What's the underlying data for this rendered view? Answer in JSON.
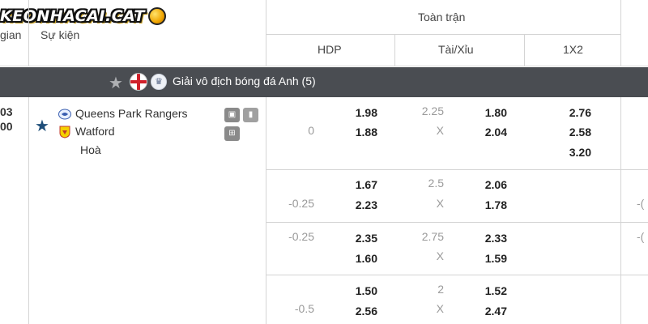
{
  "brand": {
    "logo_text": "KEONHACAI.CAT"
  },
  "header": {
    "time_col": "gian",
    "event_col": "Sự kiện",
    "full_match": "Toàn trận",
    "hdp": "HDP",
    "ou": "Tài/Xỉu",
    "x12": "1X2"
  },
  "league": {
    "name": "Giải vô địch bóng đá Anh (5)"
  },
  "match": {
    "time_top": "03",
    "time_bottom": "00",
    "home": "Queens Park Rangers",
    "away": "Watford",
    "draw": "Hoà"
  },
  "odds_rows": [
    {
      "hdp_line": "0",
      "hdp_home": "1.98",
      "hdp_away": "1.88",
      "ou_line": "2.25",
      "ou_x": "X",
      "ou_over": "1.80",
      "ou_under": "2.04",
      "x12_1": "2.76",
      "x12_2": "2.58",
      "x12_x": "3.20"
    },
    {
      "hdp_line": "-0.25",
      "hdp_home": "1.67",
      "hdp_away": "2.23",
      "ou_line": "2.5",
      "ou_x": "X",
      "ou_over": "2.06",
      "ou_under": "1.78",
      "edge": "-("
    },
    {
      "hdp_line": "-0.25",
      "hdp_home": "2.35",
      "hdp_away": "1.60",
      "ou_line": "2.75",
      "ou_x": "X",
      "ou_over": "2.33",
      "ou_under": "1.59",
      "edge": "-("
    },
    {
      "hdp_line": "-0.5",
      "hdp_home": "1.50",
      "hdp_away": "2.56",
      "ou_line": "2",
      "ou_x": "X",
      "ou_over": "1.52",
      "ou_under": "2.47"
    }
  ],
  "colors": {
    "league_bar": "#4a4d52",
    "star": "#1f4e79",
    "odd_text": "#222222",
    "line_text": "#9a9a9a"
  }
}
